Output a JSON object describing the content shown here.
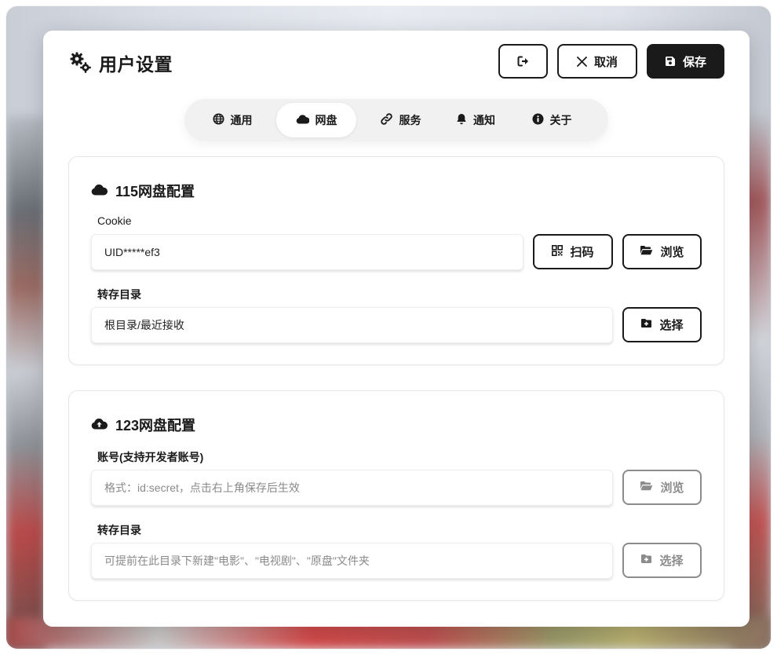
{
  "header": {
    "title": "用户设置",
    "title_icon": "gears-icon",
    "logout_icon": "sign-out-icon",
    "cancel_label": "取消",
    "cancel_icon": "close-icon",
    "save_label": "保存",
    "save_icon": "floppy-disk-icon"
  },
  "tabs": [
    {
      "label": "通用",
      "icon": "globe-icon",
      "active": false
    },
    {
      "label": "网盘",
      "icon": "cloud-icon",
      "active": true
    },
    {
      "label": "服务",
      "icon": "link-icon",
      "active": false
    },
    {
      "label": "通知",
      "icon": "bell-icon",
      "active": false
    },
    {
      "label": "关于",
      "icon": "info-circle-icon",
      "active": false
    }
  ],
  "pan115": {
    "title": "115网盘配置",
    "icon": "cloud-icon",
    "cookie_label": "Cookie",
    "cookie_value": "UID*****ef3",
    "scan_label": "扫码",
    "scan_icon": "qrcode-icon",
    "browse_label": "浏览",
    "browse_icon": "folder-open-icon",
    "dir_label": "转存目录",
    "dir_value": "根目录/最近接收",
    "select_label": "选择",
    "select_icon": "folder-plus-icon"
  },
  "pan123": {
    "title": "123网盘配置",
    "icon": "cloud-upload-icon",
    "account_label": "账号(支持开发者账号)",
    "account_placeholder": "格式：id:secret，点击右上角保存后生效",
    "browse_label": "浏览",
    "browse_icon": "folder-open-icon",
    "dir_label": "转存目录",
    "dir_placeholder": "可提前在此目录下新建\"电影\"、\"电视剧\"、\"原盘\"文件夹",
    "select_label": "选择",
    "select_icon": "folder-plus-icon"
  },
  "colors": {
    "primary": "#1a1a1a",
    "disabled": "#8c8c8c",
    "tab_bg": "#f1f1f1",
    "placeholder": "#8a8a8a"
  }
}
